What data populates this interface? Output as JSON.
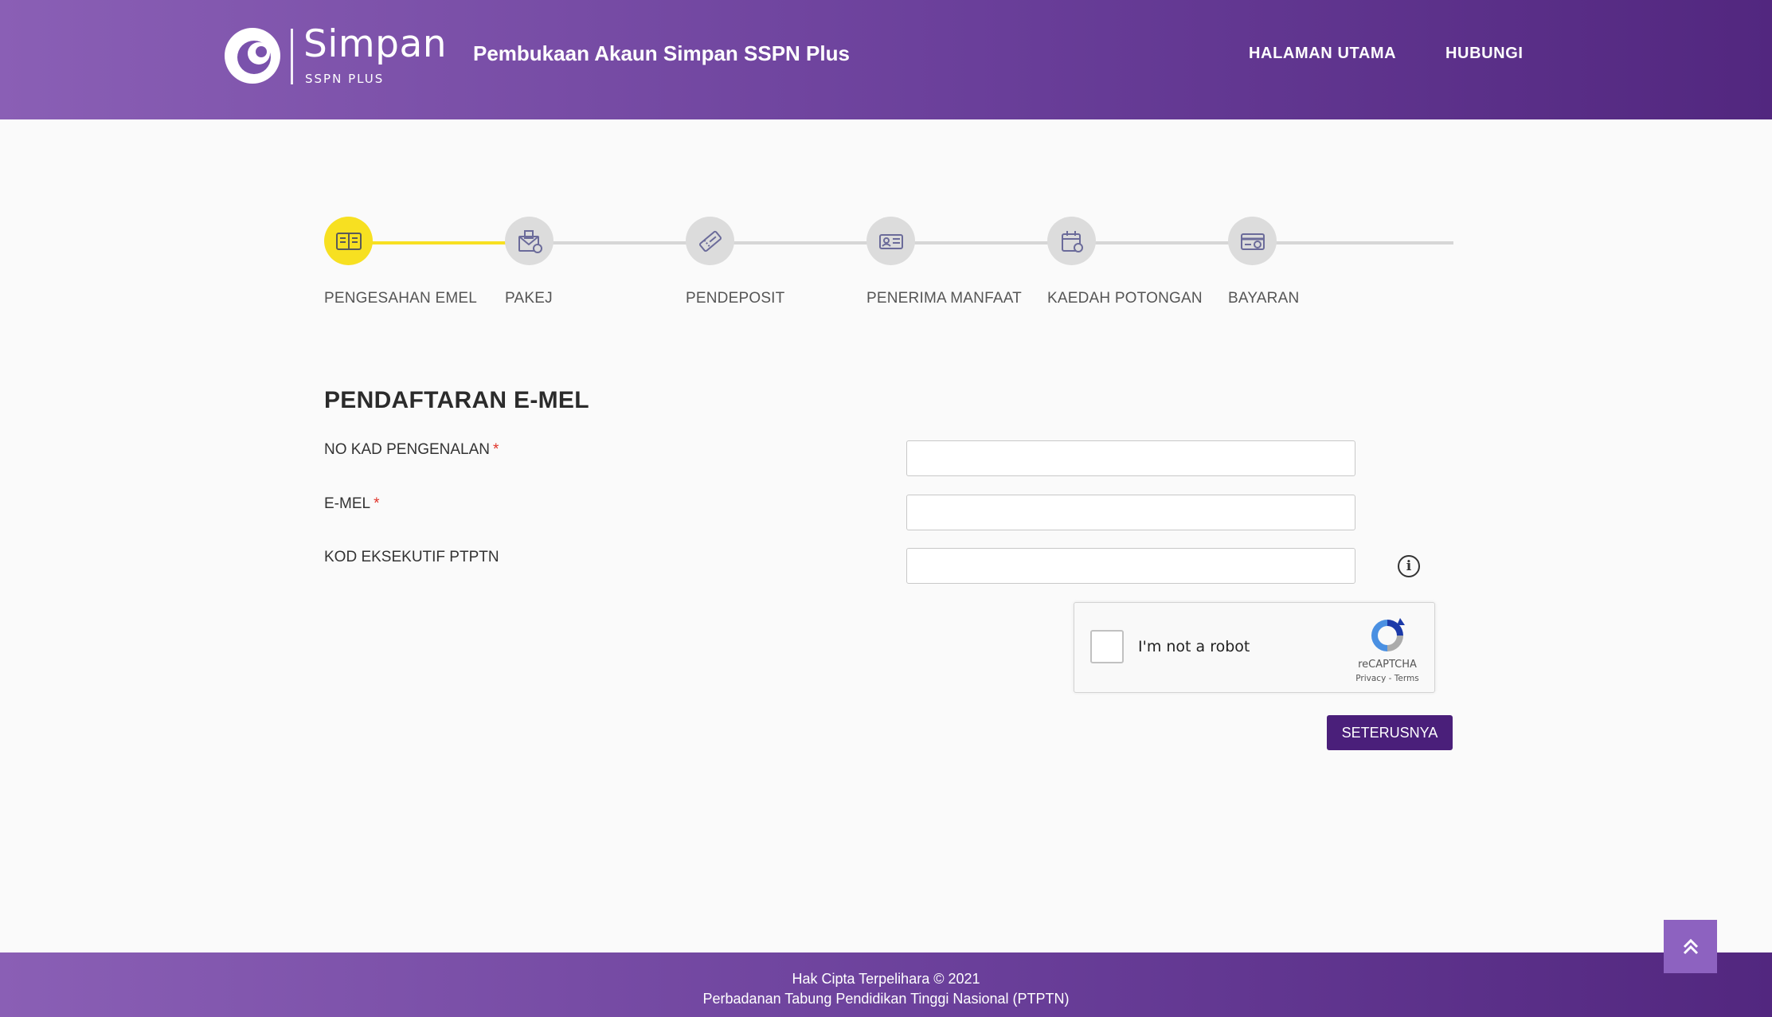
{
  "header": {
    "logo_name": "Simpan",
    "logo_sub": "SSPN PLUS",
    "title": "Pembukaan Akaun Simpan SSPN Plus",
    "nav": [
      {
        "label": "HALAMAN UTAMA"
      },
      {
        "label": "HUBUNGI"
      }
    ]
  },
  "stepper": {
    "steps": [
      {
        "label": "PENGESAHAN EMEL",
        "icon": "id-card-icon",
        "active": true
      },
      {
        "label": "PAKEJ",
        "icon": "envelope-gift-icon",
        "active": false
      },
      {
        "label": "PENDEPOSIT",
        "icon": "ticket-icon",
        "active": false
      },
      {
        "label": "PENERIMA MANFAAT",
        "icon": "beneficiary-card-icon",
        "active": false
      },
      {
        "label": "KAEDAH POTONGAN",
        "icon": "deduction-calendar-icon",
        "active": false
      },
      {
        "label": "BAYARAN",
        "icon": "payment-card-icon",
        "active": false
      }
    ],
    "active_color": "#f7e021",
    "inactive_color": "#dcdcdc"
  },
  "form": {
    "title": "PENDAFTARAN E-MEL",
    "fields": [
      {
        "label": "NO KAD PENGENALAN",
        "required_mark": "*",
        "value": ""
      },
      {
        "label": "E-MEL",
        "required_mark": "*",
        "value": ""
      },
      {
        "label": "KOD EKSEKUTIF PTPTN",
        "value": ""
      }
    ],
    "info_icon": "i"
  },
  "captcha": {
    "label": "I'm not a robot",
    "brand": "reCAPTCHA",
    "privacy": "Privacy",
    "separator": " - ",
    "terms": "Terms"
  },
  "next_button": {
    "label": "SETERUSNYA",
    "color": "#4a1f7a"
  },
  "footer": {
    "line1": "Hak Cipta Terpelihara © 2021",
    "line2": "Perbadanan Tabung Pendidikan Tinggi Nasional (PTPTN)"
  },
  "colors": {
    "header_gradient_start": "#8a5fb5",
    "header_gradient_end": "#52277f",
    "accent": "#f7e021"
  }
}
